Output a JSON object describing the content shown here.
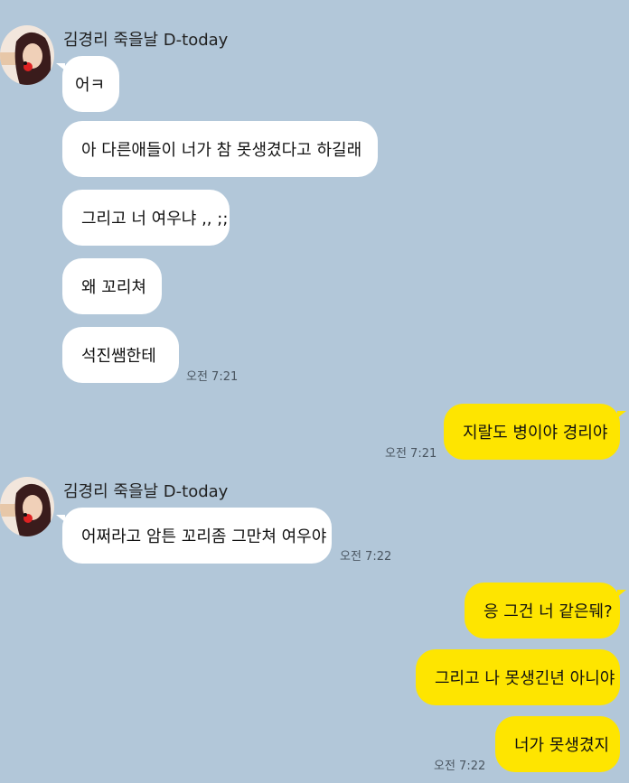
{
  "colors": {
    "background": "#b2c7d9",
    "incoming_bubble": "#ffffff",
    "outgoing_bubble": "#fee500"
  },
  "conversation": {
    "sender_name": "김경리 죽을날 D-today",
    "group1": {
      "messages": [
        "어ㅋ",
        "아 다른애들이 너가 참 못생겼다고 하길래",
        "그리고 너 여우냐 ,, ;;",
        "왜 꼬리쳐",
        "석진쌤한테"
      ],
      "time": "오전 7:21"
    },
    "reply1": {
      "messages": [
        "지랄도 병이야 경리야"
      ],
      "time": "오전 7:21"
    },
    "group2": {
      "messages": [
        "어쩌라고 암튼 꼬리좀 그만쳐 여우야"
      ],
      "time": "오전 7:22"
    },
    "reply2": {
      "messages": [
        "응 그건 너 같은뒈?",
        "그리고 나 못생긴년 아니야",
        "너가 못생겼지"
      ],
      "time": "오전 7:22"
    }
  }
}
